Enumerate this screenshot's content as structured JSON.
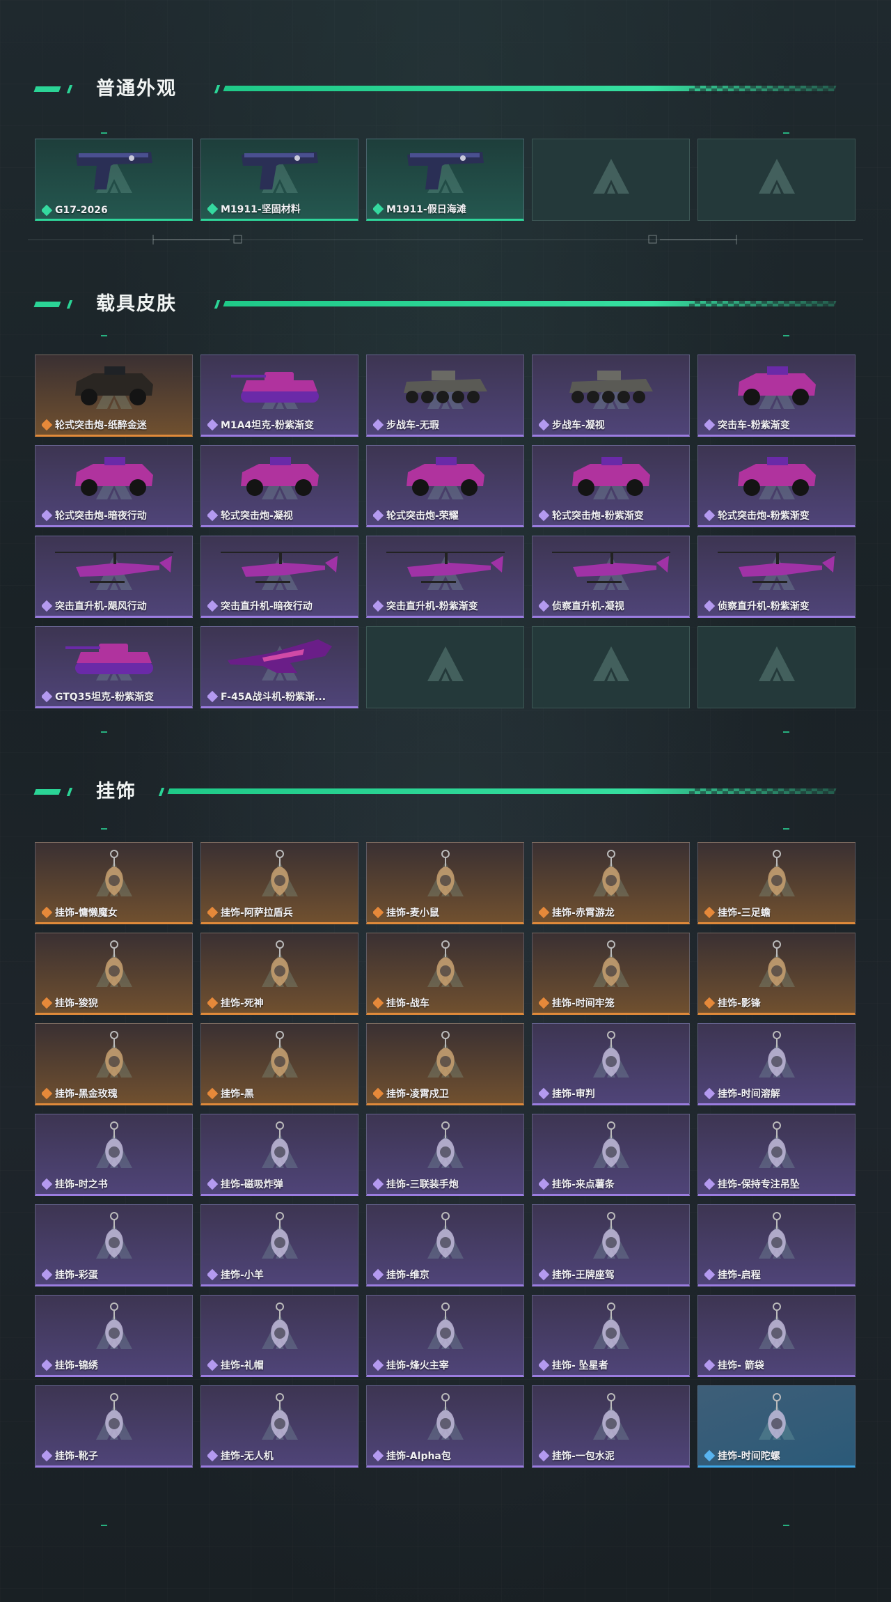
{
  "sections": [
    {
      "title": "普通外观",
      "rarity_color": "#2fd59a",
      "items": [
        {
          "label": "G17-2026",
          "rarity": "green",
          "icon": "pistol-icon"
        },
        {
          "label": "M1911-坚固材料",
          "rarity": "green",
          "icon": "pistol-icon"
        },
        {
          "label": "M1911-假日海滩",
          "rarity": "green",
          "icon": "pistol-icon"
        },
        {
          "label": "",
          "rarity": "empty",
          "icon": "delta-logo-icon"
        },
        {
          "label": "",
          "rarity": "empty",
          "icon": "delta-logo-icon"
        }
      ]
    },
    {
      "title": "载具皮肤",
      "items": [
        {
          "label": "轮式突击炮-纸醉金迷",
          "rarity": "orange",
          "icon": "armored-vehicle-icon"
        },
        {
          "label": "M1A4坦克-粉紫渐变",
          "rarity": "purple",
          "icon": "tank-icon"
        },
        {
          "label": "步战车-无瑕",
          "rarity": "purple",
          "icon": "ifv-icon"
        },
        {
          "label": "步战车-凝视",
          "rarity": "purple",
          "icon": "ifv-icon"
        },
        {
          "label": "突击车-粉紫渐变",
          "rarity": "purple",
          "icon": "assault-vehicle-icon"
        },
        {
          "label": "轮式突击炮-暗夜行动",
          "rarity": "purple",
          "icon": "armored-vehicle-icon"
        },
        {
          "label": "轮式突击炮-凝视",
          "rarity": "purple",
          "icon": "armored-vehicle-icon"
        },
        {
          "label": "轮式突击炮-荣耀",
          "rarity": "purple",
          "icon": "armored-vehicle-icon"
        },
        {
          "label": "轮式突击炮-粉紫渐变",
          "rarity": "purple",
          "icon": "armored-vehicle-icon"
        },
        {
          "label": "轮式突击炮-粉紫渐变",
          "rarity": "purple",
          "icon": "armored-vehicle-icon"
        },
        {
          "label": "突击直升机-飓风行动",
          "rarity": "purple",
          "icon": "attack-helicopter-icon"
        },
        {
          "label": "突击直升机-暗夜行动",
          "rarity": "purple",
          "icon": "attack-helicopter-icon"
        },
        {
          "label": "突击直升机-粉紫渐变",
          "rarity": "purple",
          "icon": "attack-helicopter-icon"
        },
        {
          "label": "侦察直升机-凝视",
          "rarity": "purple",
          "icon": "scout-helicopter-icon"
        },
        {
          "label": "侦察直升机-粉紫渐变",
          "rarity": "purple",
          "icon": "scout-helicopter-icon"
        },
        {
          "label": "GTQ35坦克-粉紫渐变",
          "rarity": "purple",
          "icon": "tank-icon"
        },
        {
          "label": "F-45A战斗机-粉紫渐...",
          "rarity": "purple",
          "icon": "fighter-jet-icon"
        },
        {
          "label": "",
          "rarity": "empty",
          "icon": "delta-logo-icon"
        },
        {
          "label": "",
          "rarity": "empty",
          "icon": "delta-logo-icon"
        },
        {
          "label": "",
          "rarity": "empty",
          "icon": "delta-logo-icon"
        }
      ]
    },
    {
      "title": "挂饰",
      "items": [
        {
          "label": "挂饰-慵懒魔女",
          "rarity": "orange",
          "icon": "charm-icon"
        },
        {
          "label": "挂饰-阿萨拉盾兵",
          "rarity": "orange",
          "icon": "charm-icon"
        },
        {
          "label": "挂饰-麦小鼠",
          "rarity": "orange",
          "icon": "charm-icon"
        },
        {
          "label": "挂饰-赤霄游龙",
          "rarity": "orange",
          "icon": "charm-icon"
        },
        {
          "label": "挂饰-三足蟾",
          "rarity": "orange",
          "icon": "charm-icon"
        },
        {
          "label": "挂饰-狻猊",
          "rarity": "orange",
          "icon": "charm-icon"
        },
        {
          "label": "挂饰-死神",
          "rarity": "orange",
          "icon": "charm-icon"
        },
        {
          "label": "挂饰-战车",
          "rarity": "orange",
          "icon": "charm-icon"
        },
        {
          "label": "挂饰-时间牢笼",
          "rarity": "orange",
          "icon": "charm-icon"
        },
        {
          "label": "挂饰-影锋",
          "rarity": "orange",
          "icon": "charm-icon"
        },
        {
          "label": "挂饰-黑金玫瑰",
          "rarity": "orange",
          "icon": "charm-icon"
        },
        {
          "label": "挂饰-黑",
          "rarity": "orange",
          "icon": "charm-icon"
        },
        {
          "label": "挂饰-凌霄戍卫",
          "rarity": "orange",
          "icon": "charm-icon"
        },
        {
          "label": "挂饰-审判",
          "rarity": "purple",
          "icon": "charm-icon"
        },
        {
          "label": "挂饰-时间溶解",
          "rarity": "purple",
          "icon": "charm-icon"
        },
        {
          "label": "挂饰-时之书",
          "rarity": "purple",
          "icon": "charm-icon"
        },
        {
          "label": "挂饰-磁吸炸弹",
          "rarity": "purple",
          "icon": "charm-icon"
        },
        {
          "label": "挂饰-三联装手炮",
          "rarity": "purple",
          "icon": "charm-icon"
        },
        {
          "label": "挂饰-来点薯条",
          "rarity": "purple",
          "icon": "charm-icon"
        },
        {
          "label": "挂饰-保持专注吊坠",
          "rarity": "purple",
          "icon": "charm-icon"
        },
        {
          "label": "挂饰-彩蛋",
          "rarity": "purple",
          "icon": "charm-icon"
        },
        {
          "label": "挂饰-小羊",
          "rarity": "purple",
          "icon": "charm-icon"
        },
        {
          "label": "挂饰-维京",
          "rarity": "purple",
          "icon": "charm-icon"
        },
        {
          "label": "挂饰-王牌座驾",
          "rarity": "purple",
          "icon": "charm-icon"
        },
        {
          "label": "挂饰-启程",
          "rarity": "purple",
          "icon": "charm-icon"
        },
        {
          "label": "挂饰-锦绣",
          "rarity": "purple",
          "icon": "charm-icon"
        },
        {
          "label": "挂饰-礼帽",
          "rarity": "purple",
          "icon": "charm-icon"
        },
        {
          "label": "挂饰-烽火主宰",
          "rarity": "purple",
          "icon": "charm-icon"
        },
        {
          "label": "挂饰- 坠星者",
          "rarity": "purple",
          "icon": "charm-icon"
        },
        {
          "label": "挂饰- 箭袋",
          "rarity": "purple",
          "icon": "charm-icon"
        },
        {
          "label": "挂饰-靴子",
          "rarity": "purple",
          "icon": "charm-icon"
        },
        {
          "label": "挂饰-无人机",
          "rarity": "purple",
          "icon": "charm-icon"
        },
        {
          "label": "挂饰-Alpha包",
          "rarity": "purple",
          "icon": "charm-icon"
        },
        {
          "label": "挂饰-一包水泥",
          "rarity": "purple",
          "icon": "charm-icon"
        },
        {
          "label": "挂饰-时间陀螺",
          "rarity": "blue",
          "icon": "charm-icon"
        }
      ]
    }
  ],
  "colors": {
    "accent": "#2bd496",
    "green": "#2fd59a",
    "orange": "#e08a3a",
    "purple": "#9b7de0",
    "blue": "#3fa6e6"
  }
}
